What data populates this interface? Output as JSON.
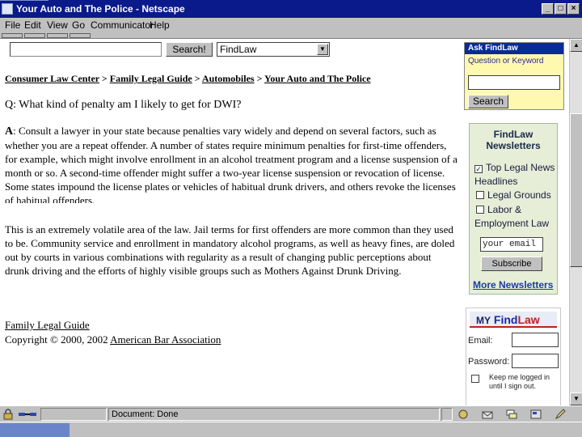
{
  "window": {
    "title": "Your Auto and The Police - Netscape",
    "controls": {
      "minimize": "_",
      "maximize": "□",
      "close": "×"
    }
  },
  "menu": [
    "File",
    "Edit",
    "View",
    "Go",
    "Communicator",
    "Help"
  ],
  "search": {
    "button_label": "Search!",
    "site_value": "FindLaw",
    "arrow": "▼"
  },
  "breadcrumb": {
    "items": [
      "Consumer Law Center",
      "Family Legal Guide",
      "Automobiles",
      "Your Auto and The Police"
    ],
    "separator": ">"
  },
  "article": {
    "question_label": "Q",
    "question": ": What kind of penalty am I likely to get for DWI?",
    "answer_label": "A",
    "answer": ": Consult a lawyer in your state because penalties vary widely and depend on several factors, such as whether you are a repeat offender. A number of states require minimum penalties for first-time offenders, for example, which might involve enrollment in an alcohol treatment program and a license suspension of a month or so. A second-time offender might suffer a two-year license suspension or revocation of license. Some states impound the license plates or vehicles of habitual drunk drivers, and others revoke the licenses of habitual offenders.",
    "paragraph2": "This is an extremely volatile area of the law. Jail terms for first offenders are more common than they used to be. Community service and enrollment in mandatory alcohol programs, as well as heavy fines, are doled out by courts in various combinations with regularity as a result of changing public perceptions about drunk driving and the efforts of highly visible groups such as Mothers Against Drunk Driving.",
    "guide_link": "Family Legal Guide",
    "copyright_prefix": "Copyright © 2000, 2002",
    "copyright_link": "American Bar Association"
  },
  "ask_findlaw": {
    "header": "Ask FindLaw",
    "label": "Question or Keyword",
    "button": "Search"
  },
  "newsletters": {
    "header_line1": "FindLaw",
    "header_line2": "Newsletters",
    "items": [
      {
        "label": "Top Legal News Headlines",
        "checked": true,
        "mark": "✓"
      },
      {
        "label": "Legal Grounds",
        "checked": false
      },
      {
        "label": "Labor & Employment Law",
        "checked": false
      }
    ],
    "email_value": "your email",
    "subscribe": "Subscribe",
    "more": "More Newsletters"
  },
  "my_findlaw": {
    "header_my": "MY",
    "header_find": "Find",
    "header_law": "Law",
    "email_label": "Email:",
    "password_label": "Password:",
    "keep_text": "Keep me logged in until I sign out."
  },
  "status": {
    "text": "Document: Done"
  },
  "colors": {
    "title_bar": "#0a1a8a",
    "chrome": "#c0c0c0",
    "ask_box_bg": "#fff9b0",
    "ask_header": "#0a2a99",
    "newsletter_bg": "#e6eed8",
    "link_blue": "#1a3aa8",
    "findlaw_red": "#c02020"
  }
}
